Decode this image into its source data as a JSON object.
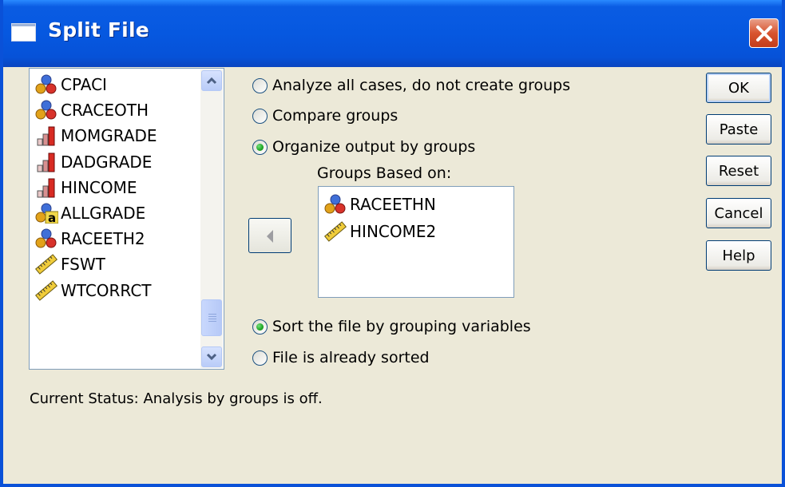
{
  "window": {
    "title": "Split File"
  },
  "variables": [
    {
      "name": "CPACI",
      "icon": "nominal-icon"
    },
    {
      "name": "CRACEOTH",
      "icon": "nominal-icon"
    },
    {
      "name": "MOMGRADE",
      "icon": "ordinal-icon"
    },
    {
      "name": "DADGRADE",
      "icon": "ordinal-icon"
    },
    {
      "name": "HINCOME",
      "icon": "ordinal-icon"
    },
    {
      "name": "ALLGRADE",
      "icon": "nominal-string-icon"
    },
    {
      "name": "RACEETH2",
      "icon": "nominal-icon"
    },
    {
      "name": "FSWT",
      "icon": "scale-icon"
    },
    {
      "name": "WTCORRCT",
      "icon": "scale-icon"
    }
  ],
  "options": {
    "analyze_all": "Analyze all cases, do not create groups",
    "compare_groups": "Compare groups",
    "organize_output": "Organize output by groups",
    "selected": "organize_output"
  },
  "groups_based_on": {
    "label": "Groups Based on:",
    "items": [
      {
        "name": "RACEETHN",
        "icon": "nominal-icon"
      },
      {
        "name": "HINCOME2",
        "icon": "scale-icon"
      }
    ]
  },
  "sort": {
    "sort_file": "Sort the file by grouping variables",
    "already_sorted": "File is already sorted",
    "selected": "sort_file"
  },
  "buttons": {
    "ok": "OK",
    "paste": "Paste",
    "reset": "Reset",
    "cancel": "Cancel",
    "help": "Help"
  },
  "status": "Current Status:  Analysis by groups is off.",
  "colors": {
    "title_bar": "#0658e0",
    "dialog_bg": "#ece9d8",
    "list_border": "#7f9db9",
    "radio_selected": "#1ea625",
    "close_button": "#d8542f"
  }
}
